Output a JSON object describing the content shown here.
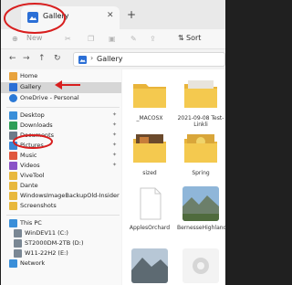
{
  "tab": {
    "title": "Gallery",
    "close_glyph": "✕",
    "new_tab_glyph": "+"
  },
  "command_bar": {
    "new_label": "New",
    "new_glyph": "⊕",
    "sort_label": "Sort",
    "sort_glyph": "⇅"
  },
  "address_bar": {
    "path": "Gallery",
    "separator": "›"
  },
  "nav_pane": {
    "items": [
      {
        "label": "Home",
        "icon": "home-icon",
        "color": "#e8a33d"
      },
      {
        "label": "Gallery",
        "icon": "gallery-icon",
        "color": "#2b6fd6"
      },
      {
        "label": "OneDrive - Personal",
        "icon": "cloud-icon",
        "color": "#2b79d6"
      },
      {
        "label": "Desktop",
        "icon": "desktop-icon",
        "color": "#3a8fd9"
      },
      {
        "label": "Downloads",
        "icon": "download-icon",
        "color": "#2f9e57"
      },
      {
        "label": "Documents",
        "icon": "document-icon",
        "color": "#6d7b8a"
      },
      {
        "label": "Pictures",
        "icon": "pictures-icon",
        "color": "#3b86d6"
      },
      {
        "label": "Music",
        "icon": "music-icon",
        "color": "#e0573d"
      },
      {
        "label": "Videos",
        "icon": "video-icon",
        "color": "#8a53c7"
      },
      {
        "label": "ViveTool",
        "icon": "folder-icon",
        "color": "#e8b83d"
      },
      {
        "label": "Dante",
        "icon": "folder-icon",
        "color": "#e8b83d"
      },
      {
        "label": "WindowsImageBackupOld-Insider",
        "icon": "folder-icon",
        "color": "#e8b83d"
      },
      {
        "label": "Screenshots",
        "icon": "folder-icon",
        "color": "#e8b83d"
      },
      {
        "label": "This PC",
        "icon": "pc-icon",
        "color": "#3a8fd9"
      },
      {
        "label": "WinDEV11 (C:)",
        "icon": "drive-icon",
        "color": "#7a8794"
      },
      {
        "label": "ST2000DM-2TB (D:)",
        "icon": "drive-icon",
        "color": "#7a8794"
      },
      {
        "label": "W11-22H2 (E:)",
        "icon": "drive-icon",
        "color": "#7a8794"
      },
      {
        "label": "Network",
        "icon": "network-icon",
        "color": "#3a8fd9"
      }
    ]
  },
  "content": {
    "tiles": [
      {
        "label": "_MACOSX",
        "kind": "folder"
      },
      {
        "label": "2021-09-08 Test-Linkli",
        "kind": "folder-photo"
      },
      {
        "label": "sized",
        "kind": "folder-photo2"
      },
      {
        "label": "Spring",
        "kind": "folder-photo3"
      },
      {
        "label": "ApplesOrchard",
        "kind": "file"
      },
      {
        "label": "BernesseHighlandsSwitzerland.jpg",
        "kind": "photo"
      },
      {
        "label": "",
        "kind": "photo2"
      },
      {
        "label": "",
        "kind": "gear"
      }
    ]
  },
  "colors": {
    "annotation": "#d81e1e",
    "accent": "#2b6fd6",
    "folder": "#f2c24c"
  }
}
